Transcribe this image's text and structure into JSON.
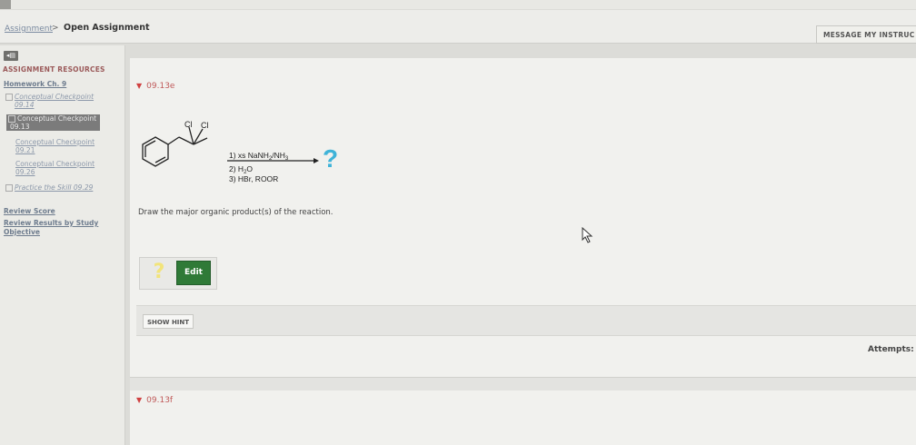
{
  "top_tabs": [
    "",
    ""
  ],
  "breadcrumb": {
    "link": "Assignment",
    "separator": ">",
    "current": "Open Assignment"
  },
  "header": {
    "message_button": "MESSAGE MY INSTRUC"
  },
  "sidebar": {
    "collapse_icon": "collapse-arrow-icon",
    "resources_title": "ASSIGNMENT RESOURCES",
    "homework_link": "Homework Ch. 9",
    "items": [
      {
        "label": "Conceptual Checkpoint",
        "sub": "09.14"
      },
      {
        "label": "Conceptual Checkpoint",
        "sub": "09.13"
      },
      {
        "label": "Conceptual Checkpoint",
        "sub": "09.21"
      },
      {
        "label": "Conceptual Checkpoint",
        "sub": "09.26"
      },
      {
        "label": "Practice the Skill 09.29",
        "sub": ""
      }
    ],
    "review_score": "Review Score",
    "review_results_line1": "Review Results by Study",
    "review_results_line2": "Objective"
  },
  "question": {
    "id": "09.13e",
    "reagent_1": "1) xs NaNH",
    "reagent_1_sub_a": "2",
    "reagent_1_mid": "/NH",
    "reagent_1_sub_b": "3",
    "reagent_2": "2) H",
    "reagent_2_sub": "2",
    "reagent_2_tail": "O",
    "reagent_3": "3) HBr, ROOR",
    "cl_left": "Cl",
    "cl_right": "Cl",
    "product_mark": "?",
    "prompt": "Draw the major organic product(s) of the reaction.",
    "answer_placeholder": "?",
    "edit_button": "Edit",
    "hint_button": "SHOW HINT",
    "attempts_label": "Attempts:"
  },
  "next_question": {
    "id": "09.13f"
  },
  "colors": {
    "accent_green": "#2f7a37",
    "question_red": "#c05a5a",
    "product_cyan": "#3fb3d8"
  }
}
